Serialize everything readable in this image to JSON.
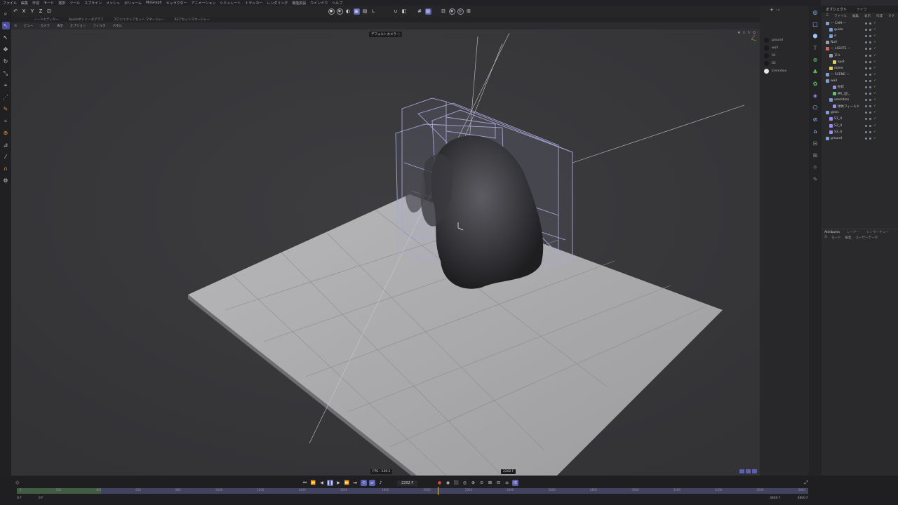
{
  "menubar": {
    "items": [
      "ファイル",
      "編集",
      "作成",
      "モード",
      "選択",
      "ツール",
      "スプライン",
      "メッシュ",
      "ボリューム",
      "MoGraph",
      "キャラクター",
      "アニメーション",
      "シミュレート",
      "トラッカー",
      "レンダリング",
      "機能拡張",
      "ウインドウ",
      "ヘルプ"
    ]
  },
  "toolbar": {
    "axes": [
      "X",
      "Y",
      "Z"
    ]
  },
  "tabbar": {
    "items": [
      "ノードエディター",
      "Redshiftシェーダグラフ",
      "プロジェクトアセット マネージャー",
      "RSアセットマネージャー"
    ]
  },
  "viewport_menu": {
    "items": [
      "ビュー",
      "カメラ",
      "表示",
      "オプション",
      "フィルタ",
      "パネル"
    ]
  },
  "viewport": {
    "camera_label": "デフォルトカメラ ◌",
    "fps_label": "FPS : 139.1",
    "frame_label": "2202 F"
  },
  "swatches": {
    "items": [
      {
        "label": "ground",
        "color": "#1a1a1a"
      },
      {
        "label": "wall",
        "color": "#1a1a1a"
      },
      {
        "label": "01",
        "color": "#1a1a1a"
      },
      {
        "label": "02",
        "color": "#1a1a1a"
      },
      {
        "label": "Emmition",
        "color": "#e8e8e8"
      }
    ]
  },
  "object_panel": {
    "tabs": [
      "オブジェクト",
      "テイク"
    ],
    "menu": [
      "ファイル",
      "編集",
      "表示",
      "作成",
      "タグ",
      "ブックマーク"
    ],
    "tree": [
      {
        "label": "— CAM —",
        "indent": 0,
        "color": "#7aa0d8"
      },
      {
        "label": "guide",
        "indent": 1,
        "color": "#7aa0d8"
      },
      {
        "label": "A",
        "indent": 1,
        "color": "#7aa0d8"
      },
      {
        "label": "Null",
        "indent": 0,
        "color": "#9aa0a8"
      },
      {
        "label": "— LIGHTS —",
        "indent": 0,
        "color": "#d86060"
      },
      {
        "label": "ヌル",
        "indent": 1,
        "color": "#9aa0a8"
      },
      {
        "label": "spot",
        "indent": 2,
        "color": "#e0d060"
      },
      {
        "label": "dome",
        "indent": 1,
        "color": "#e0d060"
      },
      {
        "label": "— SCENE —",
        "indent": 0,
        "color": "#7aa0d8"
      },
      {
        "label": "wall",
        "indent": 0,
        "color": "#7aa0d8"
      },
      {
        "label": "形状",
        "indent": 2,
        "color": "#9c8cf0"
      },
      {
        "label": "押し出し",
        "indent": 2,
        "color": "#61c46a"
      },
      {
        "label": "emmition",
        "indent": 1,
        "color": "#7aa0d8"
      },
      {
        "label": "球体フィールド",
        "indent": 2,
        "color": "#9c8cf0"
      },
      {
        "label": "glass",
        "indent": 0,
        "color": "#7aa0d8"
      },
      {
        "label": "S1_U",
        "indent": 1,
        "color": "#9c8cf0"
      },
      {
        "label": "S2_U",
        "indent": 1,
        "color": "#9c8cf0"
      },
      {
        "label": "S3_U",
        "indent": 1,
        "color": "#9c8cf0"
      },
      {
        "label": "ground",
        "indent": 0,
        "color": "#7aa0d8"
      }
    ]
  },
  "attributes": {
    "tabs": [
      "Attributes",
      "レイヤー",
      "レンダーキュー"
    ],
    "menu": [
      "モード",
      "編集",
      "ユーザーデータ"
    ]
  },
  "timeline": {
    "current_frame": "2202 F",
    "ticks": [
      "0",
      "100",
      "200",
      "300",
      "400",
      "500",
      "600",
      "700",
      "800",
      "900",
      "1000",
      "1100",
      "1200",
      "1300",
      "1400",
      "1500",
      "1600",
      "1700",
      "1800",
      "1900",
      "2000",
      "2100",
      "2200",
      "2300",
      "2400",
      "2500",
      "2600",
      "2700",
      "2800",
      "2900",
      "3000",
      "3100",
      "3200",
      "3300",
      "3400",
      "3500",
      "3600",
      "3700",
      "3800"
    ],
    "range_start_1": "0 F",
    "range_start_2": "0 F",
    "range_end_1": "3800 F",
    "range_end_2": "3800 F"
  }
}
